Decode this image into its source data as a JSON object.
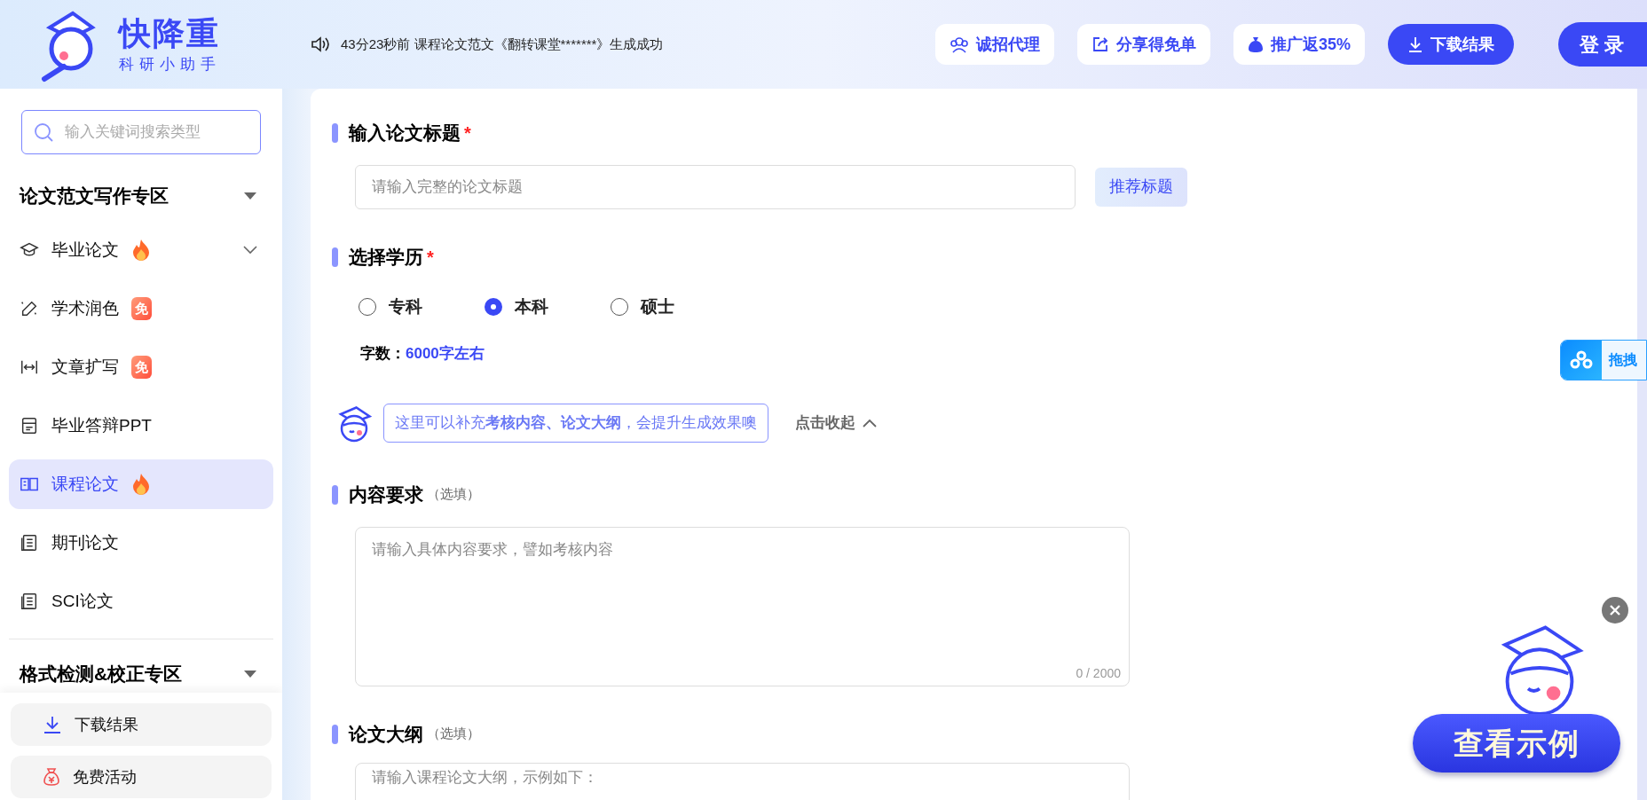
{
  "header": {
    "brand": {
      "name": "快降重",
      "slogan": "科研小助手"
    },
    "notice": "43分23秒前 课程论文范文《翻转课堂*******》生成成功",
    "actions": [
      {
        "label": "诚招代理",
        "kind": "plain"
      },
      {
        "label": "分享得免单",
        "kind": "plain"
      },
      {
        "label": "推广返35%",
        "kind": "plain"
      },
      {
        "label": "下载结果",
        "kind": "primary"
      }
    ],
    "login": "登 录"
  },
  "sidebar": {
    "search": {
      "placeholder": "输入关键词搜索类型"
    },
    "sections": [
      {
        "title": "论文范文写作专区",
        "items": [
          {
            "label": "毕业论文",
            "hot": true,
            "kind": "group",
            "expanded": false,
            "selected": false
          },
          {
            "label": "学术润色",
            "hot": false,
            "badge": "免",
            "kind": "link",
            "selected": false
          },
          {
            "label": "文章扩写",
            "hot": false,
            "badge": "免",
            "kind": "link",
            "selected": false
          },
          {
            "label": "毕业答辩PPT",
            "hot": false,
            "kind": "link",
            "selected": false
          },
          {
            "label": "课程论文",
            "hot": true,
            "kind": "link",
            "selected": true
          },
          {
            "label": "期刊论文",
            "hot": false,
            "kind": "link",
            "selected": false
          },
          {
            "label": "SCI论文",
            "hot": false,
            "kind": "link",
            "selected": false
          }
        ]
      },
      {
        "title": "格式检测&校正专区"
      }
    ],
    "bottom_buttons": [
      {
        "label": "下载结果"
      },
      {
        "label": "免费活动"
      }
    ]
  },
  "form": {
    "title_field": {
      "label": "输入论文标题",
      "required_mark": "*",
      "placeholder": "请输入完整的论文标题",
      "suggest_button": "推荐标题"
    },
    "education": {
      "label": "选择学历",
      "required_mark": "*",
      "options": [
        {
          "label": "专科",
          "selected": false
        },
        {
          "label": "本科",
          "selected": true
        },
        {
          "label": "硕士",
          "selected": false
        }
      ]
    },
    "word_count": {
      "label": "字数：",
      "value": "6000字左右"
    },
    "tip": {
      "text": "这里可以补充**考核内容、论文大纲**，会提升生成效果噢",
      "toggle": "点击收起"
    },
    "content": {
      "label": "内容要求",
      "note": "（选填）",
      "placeholder": "请输入具体内容要求，譬如考核内容",
      "counter": "0 / 2000"
    },
    "outline": {
      "label": "论文大纲",
      "note": "（选填）",
      "placeholder": "请输入课程论文大纲，示例如下："
    }
  },
  "floating": {
    "drag_tab": "拖拽",
    "example_button": "查看示例"
  }
}
